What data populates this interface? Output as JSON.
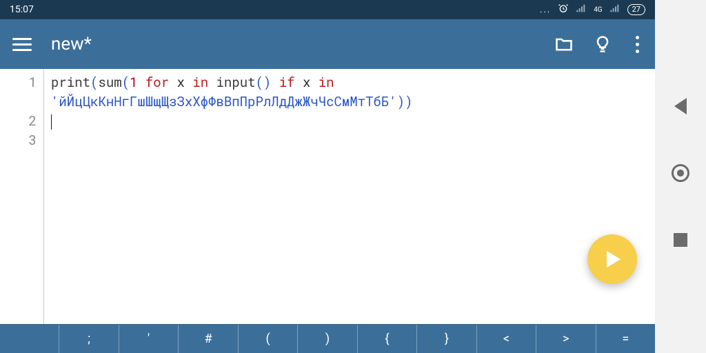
{
  "status": {
    "time": "15:07",
    "dots": "...",
    "network_label": "4G",
    "battery": "27"
  },
  "appbar": {
    "title": "new*"
  },
  "icons": {
    "menu": "menu-icon",
    "folder": "folder-icon",
    "bulb": "lightbulb-icon",
    "overflow": "overflow-icon",
    "run": "play-icon"
  },
  "editor": {
    "lines": [
      {
        "n": "1"
      },
      {
        "n": "2"
      },
      {
        "n": "3"
      }
    ],
    "code": {
      "call1": "print",
      "call2": "sum",
      "one": "1",
      "for": "for",
      "x1": "x",
      "in1": "in",
      "input": "input",
      "if": "if",
      "x2": "x",
      "in2": "in",
      "string": "'йЙцЦкКнНгГшШщЩзЗхХфФвВпПрРлЛдДжЖчЧсСмМтТбБ'",
      "lp": "(",
      "rp": ")",
      "rp2": "))",
      "empty_paren": "()"
    }
  },
  "symbar": [
    "",
    ";",
    "'",
    "#",
    "(",
    ")",
    "{",
    "}",
    "<",
    ">",
    "="
  ],
  "nav": {
    "back": "back",
    "home": "home",
    "recent": "recent"
  }
}
